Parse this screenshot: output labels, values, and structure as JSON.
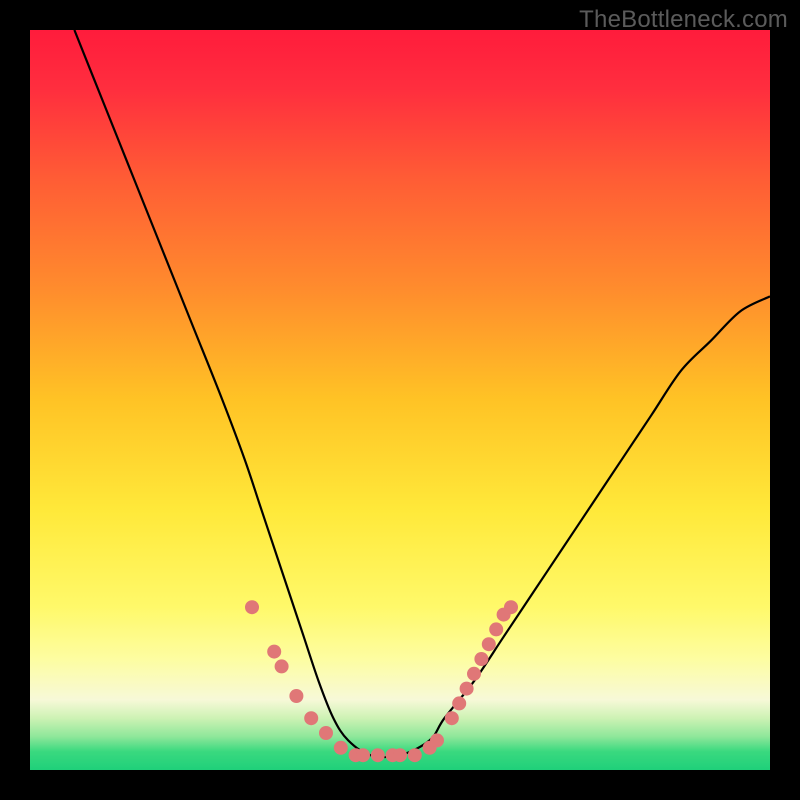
{
  "watermark": "TheBottleneck.com",
  "colors": {
    "bg_black": "#000000",
    "marker": "#E07777",
    "curve": "#000000"
  },
  "chart_data": {
    "type": "line",
    "title": "",
    "xlabel": "",
    "ylabel": "",
    "xlim": [
      0,
      100
    ],
    "ylim": [
      0,
      100
    ],
    "grid": false,
    "legend": "none",
    "annotations": [
      "TheBottleneck.com"
    ],
    "background": {
      "type": "vertical-gradient",
      "stops": [
        {
          "pos": 0.0,
          "color": "#ff1c3c"
        },
        {
          "pos": 0.08,
          "color": "#ff2e3e"
        },
        {
          "pos": 0.2,
          "color": "#ff5c35"
        },
        {
          "pos": 0.35,
          "color": "#ff8c2d"
        },
        {
          "pos": 0.5,
          "color": "#ffc325"
        },
        {
          "pos": 0.65,
          "color": "#ffe93a"
        },
        {
          "pos": 0.78,
          "color": "#fff96a"
        },
        {
          "pos": 0.85,
          "color": "#fdfda1"
        },
        {
          "pos": 0.905,
          "color": "#f7f9d8"
        },
        {
          "pos": 0.93,
          "color": "#cdf2b4"
        },
        {
          "pos": 0.955,
          "color": "#8ee79a"
        },
        {
          "pos": 0.975,
          "color": "#3ad97f"
        },
        {
          "pos": 1.0,
          "color": "#1fd07a"
        }
      ]
    },
    "series": [
      {
        "name": "bottleneck-curve",
        "x": [
          6,
          10,
          14,
          18,
          22,
          26,
          29,
          31,
          33,
          35,
          37,
          39,
          41,
          43,
          46,
          50,
          54,
          56,
          60,
          64,
          68,
          72,
          76,
          80,
          84,
          88,
          92,
          96,
          100
        ],
        "y": [
          100,
          90,
          80,
          70,
          60,
          50,
          42,
          36,
          30,
          24,
          18,
          12,
          7,
          4,
          2,
          2,
          4,
          7,
          12,
          18,
          24,
          30,
          36,
          42,
          48,
          54,
          58,
          62,
          64
        ]
      }
    ],
    "markers": [
      {
        "x": 30,
        "y": 22
      },
      {
        "x": 33,
        "y": 16
      },
      {
        "x": 34,
        "y": 14
      },
      {
        "x": 36,
        "y": 10
      },
      {
        "x": 38,
        "y": 7
      },
      {
        "x": 40,
        "y": 5
      },
      {
        "x": 42,
        "y": 3
      },
      {
        "x": 44,
        "y": 2
      },
      {
        "x": 45,
        "y": 2
      },
      {
        "x": 47,
        "y": 2
      },
      {
        "x": 49,
        "y": 2
      },
      {
        "x": 50,
        "y": 2
      },
      {
        "x": 52,
        "y": 2
      },
      {
        "x": 54,
        "y": 3
      },
      {
        "x": 55,
        "y": 4
      },
      {
        "x": 57,
        "y": 7
      },
      {
        "x": 58,
        "y": 9
      },
      {
        "x": 59,
        "y": 11
      },
      {
        "x": 60,
        "y": 13
      },
      {
        "x": 61,
        "y": 15
      },
      {
        "x": 62,
        "y": 17
      },
      {
        "x": 63,
        "y": 19
      },
      {
        "x": 64,
        "y": 21
      },
      {
        "x": 65,
        "y": 22
      }
    ]
  }
}
